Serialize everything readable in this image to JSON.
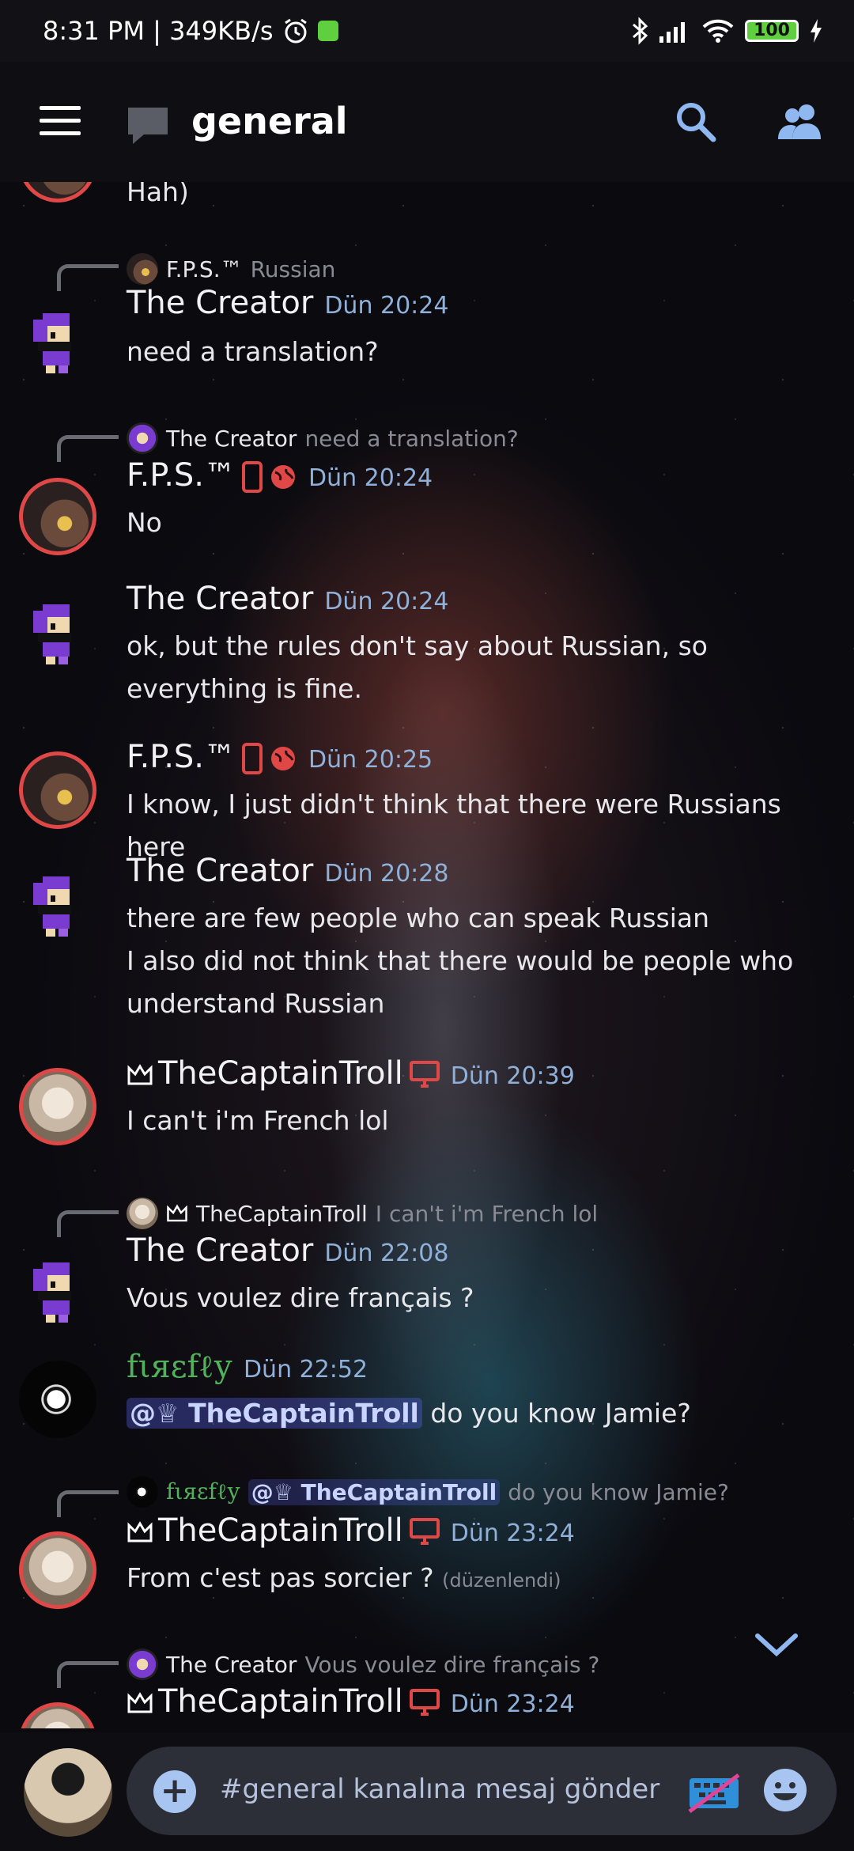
{
  "status": {
    "time_speed": "8:31 PM | 349KB/s",
    "battery": "100"
  },
  "header": {
    "channel_name": "general"
  },
  "messages": [
    {
      "kind": "fragment",
      "text": "Hah)"
    },
    {
      "kind": "reply",
      "reply_to": {
        "name": "F.P.S.™",
        "text": "Russian"
      },
      "author": "The Creator",
      "time": "Dün 20:24",
      "text": "need a translation?"
    },
    {
      "kind": "reply",
      "reply_to": {
        "name": "The Creator",
        "text": "need a translation?"
      },
      "author": "F.P.S.™",
      "time": "Dün 20:24",
      "text": "No"
    },
    {
      "kind": "message",
      "author": "The Creator",
      "time": "Dün 20:24",
      "text": "ok, but the rules don't say about Russian, so everything is fine."
    },
    {
      "kind": "message",
      "author": "F.P.S.™",
      "time": "Dün 20:25",
      "text": "I know, I just didn't think that there were Russians here"
    },
    {
      "kind": "message",
      "author": "The Creator",
      "time": "Dün 20:28",
      "text_lines": [
        "there are few people who can speak Russian",
        "I also did not think that there would be people who understand Russian"
      ]
    },
    {
      "kind": "message",
      "author": "TheCaptainTroll",
      "time": "Dün 20:39",
      "text": "I can't i'm French lol"
    },
    {
      "kind": "reply",
      "reply_to": {
        "name": "TheCaptainTroll",
        "text": "I can't i'm French lol"
      },
      "author": "The Creator",
      "time": "Dün 22:08",
      "text": "Vous voulez dire français ?"
    },
    {
      "kind": "message",
      "author": "fιяεfℓу",
      "time": "Dün 22:52",
      "mention": "@♕ TheCaptainTroll",
      "text": " do you know Jamie?"
    },
    {
      "kind": "reply",
      "reply_to": {
        "name": "fιяεfℓу",
        "mention": "@♕ TheCaptainTroll",
        "text": "do you know Jamie?"
      },
      "author": "TheCaptainTroll",
      "time": "Dün 23:24",
      "text": "From c'est pas sorcier ?",
      "edited": "(düzenlendi)"
    },
    {
      "kind": "reply",
      "reply_to": {
        "name": "The Creator",
        "text": "Vous voulez dire français ?"
      },
      "author": "TheCaptainTroll",
      "time": "Dün 23:24"
    }
  ],
  "composer": {
    "placeholder": "#general kanalına mesaj gönder"
  },
  "icons": {
    "hamburger": "menu-icon",
    "channel": "chat-bubble-icon",
    "search": "search-icon",
    "members": "members-icon",
    "crown": "crown-icon",
    "mobile": "mobile-phone-icon",
    "globe": "globe-icon",
    "desktop": "desktop-icon",
    "plus": "plus-icon",
    "keyboard": "keyboard-disabled-icon",
    "emoji": "emoji-icon",
    "chevron": "chevron-down-icon"
  },
  "colors": {
    "accent": "#8fb0d8",
    "role_red": "#e04848",
    "firefly_green": "#52b25c",
    "mention_bg": "#5865f2"
  }
}
